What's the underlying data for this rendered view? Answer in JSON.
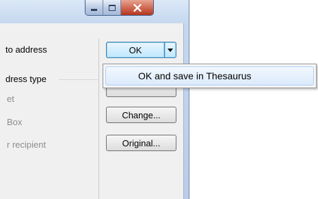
{
  "window": {
    "caption": {
      "minimize_icon": "minimize-icon",
      "maximize_icon": "maximize-icon",
      "close_icon": "close-x-icon"
    }
  },
  "left_panel": {
    "label_to_address": "to address",
    "group_title": "dress type",
    "option_1": "et",
    "option_2": "Box",
    "option_3": "r recipient"
  },
  "buttons": {
    "ok": "OK",
    "change": "Change...",
    "original": "Original..."
  },
  "dropdown_menu": {
    "items": [
      {
        "label": "OK and save in Thesaurus"
      }
    ]
  },
  "colors": {
    "accent": "#3c7fb1",
    "close_button": "#c75b44",
    "menu_highlight": "#dbeafb"
  }
}
